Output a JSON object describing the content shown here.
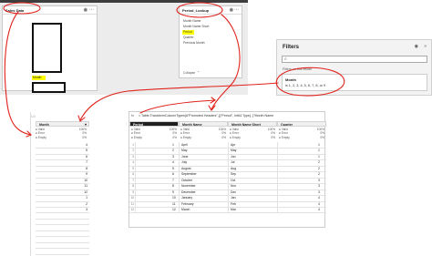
{
  "model_view": {
    "sales_card": {
      "title": "Sales Data",
      "highlight_field": "Month"
    },
    "period_card": {
      "title": "Period_Lookup",
      "fields": [
        "Month Name",
        "Month Name Short",
        "Period",
        "Quarter",
        "Previous Month"
      ],
      "highlighted_field": "Period",
      "footer": "Collapse"
    }
  },
  "filters_pane": {
    "title": "Filters",
    "section_label": "Filters on this visual",
    "filter_name": "Month",
    "filter_value": "is 1, 2, 3, 4, 5, 6, 7, 8, or 9"
  },
  "left_table": {
    "row_count_label": "1²3",
    "column": "Month",
    "stats": [
      {
        "label": "Valid",
        "value": "100%"
      },
      {
        "label": "Error",
        "value": "0%"
      },
      {
        "label": "Empty",
        "value": "0%"
      }
    ],
    "rows": [
      "4",
      "5",
      "6",
      "7",
      "8",
      "9",
      "10",
      "11",
      "12",
      "1",
      "2",
      "3"
    ]
  },
  "right_table": {
    "formula": "= Table.TransformColumnTypes(#\"Promoted Headers\",{{\"Period\", Int64.Type}, {\"Month Name",
    "columns": [
      "Period",
      "Month Name",
      "Month Name Short",
      "Quarter"
    ],
    "stats": [
      [
        {
          "label": "Valid",
          "value": "100%"
        },
        {
          "label": "Error",
          "value": "0%"
        },
        {
          "label": "Empty",
          "value": "0%"
        }
      ],
      [
        {
          "label": "Valid",
          "value": "100%"
        },
        {
          "label": "Error",
          "value": "0%"
        },
        {
          "label": "Empty",
          "value": "0%"
        }
      ],
      [
        {
          "label": "Valid",
          "value": "100%"
        },
        {
          "label": "Error",
          "value": "0%"
        },
        {
          "label": "Empty",
          "value": "0%"
        }
      ],
      [
        {
          "label": "Valid",
          "value": "100%"
        },
        {
          "label": "Error",
          "value": "0%"
        },
        {
          "label": "Empty",
          "value": "0%"
        }
      ]
    ],
    "rows": [
      {
        "n": "1",
        "period": "1",
        "name": "April",
        "short": "Apr",
        "quarter": "1"
      },
      {
        "n": "2",
        "period": "2",
        "name": "May",
        "short": "May",
        "quarter": "1"
      },
      {
        "n": "3",
        "period": "3",
        "name": "June",
        "short": "Jun",
        "quarter": "1"
      },
      {
        "n": "4",
        "period": "4",
        "name": "July",
        "short": "Jul",
        "quarter": "2"
      },
      {
        "n": "5",
        "period": "5",
        "name": "August",
        "short": "Aug",
        "quarter": "2"
      },
      {
        "n": "6",
        "period": "6",
        "name": "September",
        "short": "Sep",
        "quarter": "2"
      },
      {
        "n": "7",
        "period": "7",
        "name": "October",
        "short": "Oct",
        "quarter": "3"
      },
      {
        "n": "8",
        "period": "8",
        "name": "November",
        "short": "Nov",
        "quarter": "3"
      },
      {
        "n": "9",
        "period": "9",
        "name": "December",
        "short": "Dec",
        "quarter": "3"
      },
      {
        "n": "10",
        "period": "10",
        "name": "January",
        "short": "Jan",
        "quarter": "4"
      },
      {
        "n": "11",
        "period": "11",
        "name": "February",
        "short": "Feb",
        "quarter": "4"
      },
      {
        "n": "12",
        "period": "12",
        "name": "March",
        "short": "Mar",
        "quarter": "4"
      }
    ]
  },
  "colors": {
    "annotation": "#e0231c",
    "highlight": "#ffff00",
    "accent": "#2b6cb0"
  }
}
